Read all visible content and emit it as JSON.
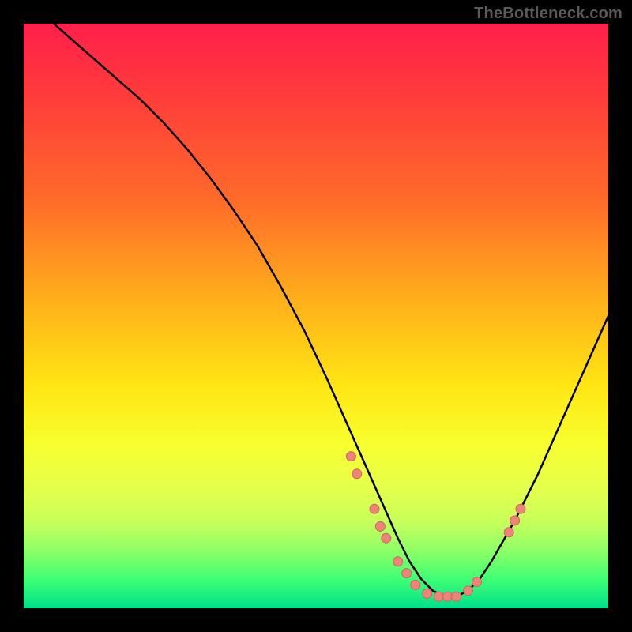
{
  "watermark": "TheBottleneck.com",
  "colors": {
    "curve_stroke": "#000000",
    "dot_fill": "#f08378",
    "dot_stroke": "#c46a60"
  },
  "chart_data": {
    "type": "line",
    "title": "",
    "xlabel": "",
    "ylabel": "",
    "xlim": [
      0,
      100
    ],
    "ylim": [
      0,
      100
    ],
    "series": [
      {
        "name": "curve",
        "x": [
          0,
          4,
          8,
          12,
          16,
          20,
          24,
          28,
          32,
          36,
          40,
          44,
          48,
          52,
          56,
          58,
          60,
          62,
          64,
          66,
          68,
          70,
          72,
          74,
          76,
          78,
          80,
          84,
          88,
          92,
          96,
          100
        ],
        "y": [
          105,
          101,
          97.5,
          94,
          90.5,
          87,
          83,
          78.5,
          73.5,
          68,
          62,
          55,
          47.5,
          39,
          30,
          25.5,
          21,
          16.5,
          12,
          8,
          5,
          3,
          2,
          2,
          3,
          5,
          8,
          15,
          23,
          32,
          41,
          50
        ]
      }
    ],
    "dots": {
      "name": "markers",
      "points": [
        {
          "x": 56,
          "y": 26
        },
        {
          "x": 57,
          "y": 23
        },
        {
          "x": 60,
          "y": 17
        },
        {
          "x": 61,
          "y": 14
        },
        {
          "x": 62,
          "y": 12
        },
        {
          "x": 64,
          "y": 8
        },
        {
          "x": 65.5,
          "y": 6
        },
        {
          "x": 67,
          "y": 4
        },
        {
          "x": 69,
          "y": 2.5
        },
        {
          "x": 71,
          "y": 2
        },
        {
          "x": 72.5,
          "y": 2
        },
        {
          "x": 74,
          "y": 2
        },
        {
          "x": 76,
          "y": 3
        },
        {
          "x": 77.5,
          "y": 4.5
        },
        {
          "x": 83,
          "y": 13
        },
        {
          "x": 84,
          "y": 15
        },
        {
          "x": 85,
          "y": 17
        }
      ],
      "radius": 6
    }
  }
}
